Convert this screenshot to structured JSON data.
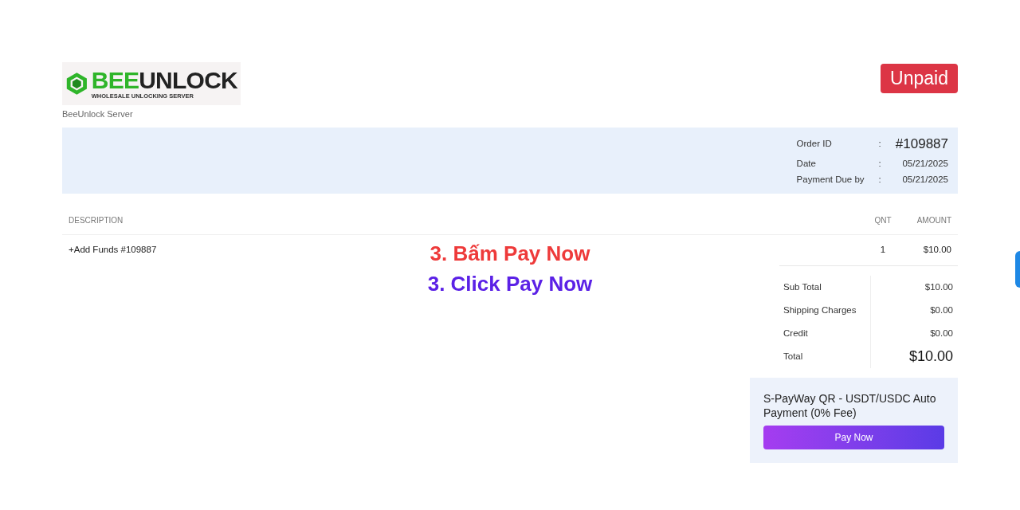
{
  "logo": {
    "brand_part_1": "BEE",
    "brand_part_2": "UNLOCK",
    "tagline": "WHOLESALE UNLOCKING SERVER"
  },
  "company": "BeeUnlock Server",
  "status_badge": "Unpaid",
  "order_info": [
    {
      "label": "Order ID",
      "separator": ":",
      "value": "#109887",
      "kind": "large"
    },
    {
      "label": "Date",
      "separator": ":",
      "value": "05/21/2025",
      "kind": "normal"
    },
    {
      "label": "Payment Due by",
      "separator": ":",
      "value": "05/21/2025",
      "kind": "normal"
    }
  ],
  "table": {
    "columns": [
      "DESCRIPTION",
      "QNT",
      "AMOUNT"
    ],
    "rows": [
      {
        "description": "+Add Funds #109887",
        "qnt": "1",
        "amount": "$10.00"
      }
    ]
  },
  "totals": [
    {
      "label": "Sub Total",
      "value": "$10.00",
      "kind": "normal"
    },
    {
      "label": "Shipping Charges",
      "value": "$0.00",
      "kind": "normal"
    },
    {
      "label": "Credit",
      "value": "$0.00",
      "kind": "normal"
    },
    {
      "label": "Total",
      "value": "$10.00",
      "kind": "large"
    }
  ],
  "payment": {
    "method": "S-PayWay QR - USDT/USDC Auto Payment (0% Fee)",
    "button": "Pay Now"
  },
  "annotations": [
    {
      "text": "3. Bấm Pay Now",
      "color": "#ee3a3a"
    },
    {
      "text": "3. Click Pay Now",
      "color": "#5b21e6"
    }
  ]
}
